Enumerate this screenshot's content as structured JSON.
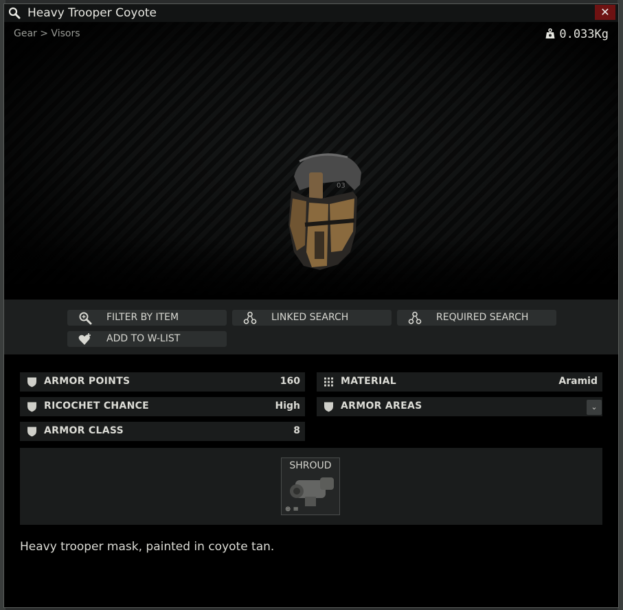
{
  "window": {
    "title": "Heavy Trooper Coyote",
    "close_label": "✕",
    "breadcrumb": "Gear > Visors",
    "weight": "0.033Kg"
  },
  "actions": [
    {
      "label": "FILTER BY ITEM",
      "icon": "filter-search-icon"
    },
    {
      "label": "LINKED SEARCH",
      "icon": "linked-search-icon"
    },
    {
      "label": "REQUIRED SEARCH",
      "icon": "required-search-icon"
    },
    {
      "label": "ADD TO W-LIST",
      "icon": "add-wishlist-icon"
    }
  ],
  "stats": [
    {
      "label": "ARMOR POINTS",
      "value": "160",
      "icon": "shield-icon"
    },
    {
      "label": "MATERIAL",
      "value": "Aramid",
      "icon": "material-grid-icon"
    },
    {
      "label": "RICOCHET CHANCE",
      "value": "High",
      "icon": "shield-icon"
    },
    {
      "label": "ARMOR AREAS",
      "value": "⌄",
      "icon": "shield-icon"
    },
    {
      "label": "ARMOR CLASS",
      "value": "8",
      "icon": "shield-icon"
    }
  ],
  "slots": [
    {
      "label": "SHROUD",
      "icon": "shroud-mount-icon"
    }
  ],
  "description": "Heavy trooper mask, painted in coyote tan.",
  "colors": {
    "close_bg": "#6e1212",
    "panel_bg": "#1a1c1c",
    "button_bg": "#2c2f2f",
    "helmet_tan": "#8a6a3e"
  }
}
